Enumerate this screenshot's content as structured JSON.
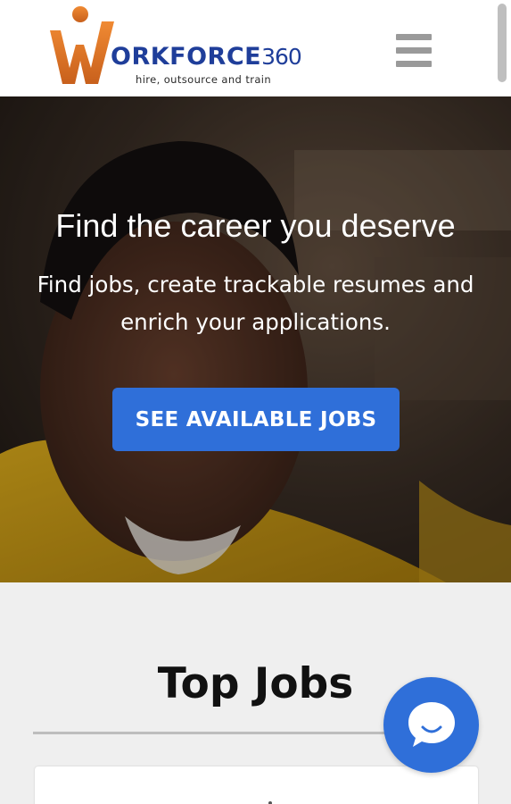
{
  "header": {
    "logo": {
      "brand_text": "ORKFORCE",
      "brand_number": "360",
      "tagline": "hire, outsource and train"
    },
    "menu_icon": "hamburger-menu-icon"
  },
  "hero": {
    "title": "Find the career you deserve",
    "subtitle": "Find jobs, create trackable resumes and enrich your applications.",
    "cta_label": "SEE AVAILABLE JOBS"
  },
  "top_jobs": {
    "title": "Top Jobs"
  },
  "chat_widget": {
    "icon": "chat-bubble-icon"
  },
  "colors": {
    "brand_blue": "#1f3e9a",
    "brand_orange": "#e0782c",
    "accent_blue": "#2f6fd9"
  }
}
